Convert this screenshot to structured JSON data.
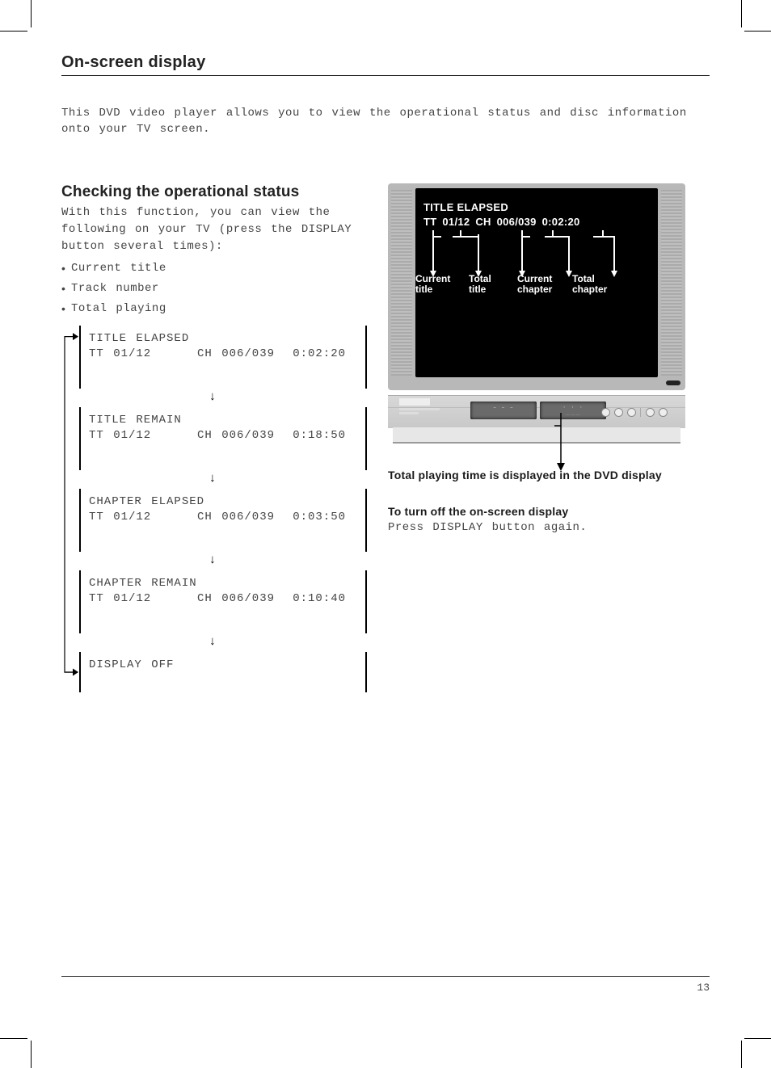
{
  "header": {
    "title": "On-screen display"
  },
  "intro": "This DVD video player allows you to view the operational status and disc information onto your TV screen.",
  "section": {
    "heading": "Checking the operational status",
    "lead": "With this function, you can view the following on your TV (press the DISPLAY button several times):",
    "bullets": [
      "Current title",
      "Track number",
      "Total playing"
    ]
  },
  "states": [
    {
      "label": "TITLE ELAPSED",
      "tt": "TT 01/12",
      "ch": "CH  006/039",
      "time": "0:02:20"
    },
    {
      "label": "TITLE REMAIN",
      "tt": "TT 01/12",
      "ch": "CH  006/039",
      "time": "0:18:50"
    },
    {
      "label": "CHAPTER ELAPSED",
      "tt": "TT 01/12",
      "ch": "CH  006/039",
      "time": "0:03:50"
    },
    {
      "label": "CHAPTER REMAIN",
      "tt": "TT 01/12",
      "ch": "CH  006/039",
      "time": "0:10:40"
    }
  ],
  "final_state": "DISPLAY OFF",
  "tv": {
    "osd_line1": "TITLE ELAPSED",
    "osd_line2": "TT 01/12  CH 006/039   0:02:20",
    "labels": {
      "a1": "Current",
      "a2": "title",
      "b1": "Total",
      "b2": "title",
      "c1": "Current",
      "c2": "chapter",
      "d1": "Total",
      "d2": "chapter"
    }
  },
  "caption": "Total playing time is displayed in the DVD display",
  "turnoff_heading": "To turn off the on-screen display",
  "turnoff_body": "Press DISPLAY button again.",
  "page_number": "13",
  "arrow_glyph": "↓",
  "bullet_glyph": "•"
}
